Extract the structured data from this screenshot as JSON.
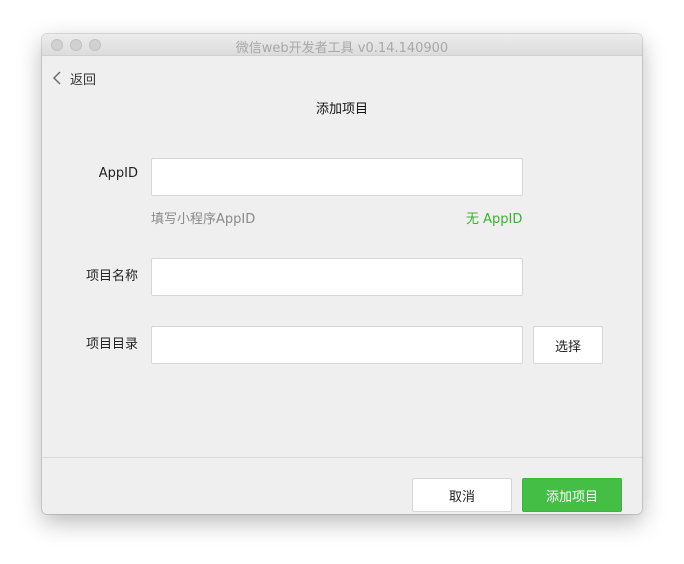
{
  "window": {
    "title": "微信web开发者工具 v0.14.140900"
  },
  "nav": {
    "back_label": "返回",
    "back_icon": "chevron-left-icon"
  },
  "page": {
    "title": "添加项目"
  },
  "form": {
    "appid": {
      "label": "AppID",
      "value": "",
      "placeholder": "",
      "hint": "填写小程序AppID",
      "no_appid_link": "无 AppID"
    },
    "project_name": {
      "label": "项目名称",
      "value": "",
      "placeholder": ""
    },
    "project_dir": {
      "label": "项目目录",
      "value": "",
      "placeholder": "",
      "choose_label": "选择"
    }
  },
  "footer": {
    "cancel_label": "取消",
    "add_label": "添加项目"
  },
  "colors": {
    "accent_green": "#45be45",
    "link_green": "#3cb034",
    "window_bg": "#efefef"
  }
}
